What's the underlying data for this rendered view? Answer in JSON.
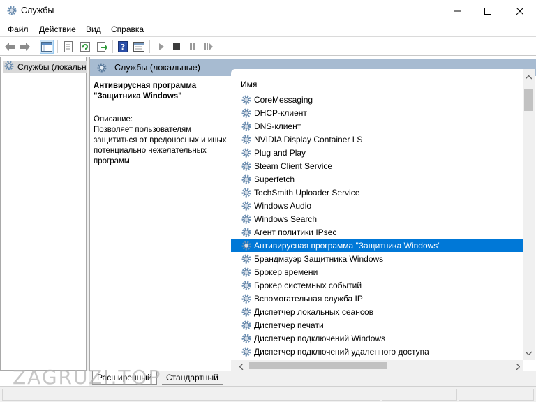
{
  "window": {
    "title": "Службы",
    "icon": "gear-icon"
  },
  "menu": {
    "items": [
      "Файл",
      "Действие",
      "Вид",
      "Справка"
    ]
  },
  "toolbar": {
    "buttons": [
      "back-icon",
      "forward-icon",
      "show-tree-icon",
      "properties-icon",
      "refresh-icon",
      "export-icon",
      "help-icon",
      "console-icon",
      "play-icon",
      "stop-icon",
      "pause-icon",
      "resume-icon"
    ]
  },
  "tree": {
    "root_label": "Службы (локальные)"
  },
  "right_pane": {
    "header_title": "Службы (локальные)",
    "selected_service_name": "Антивирусная программа \"Защитника Windows\"",
    "description_label": "Описание:",
    "description_text": "Позволяет пользователям защититься от вредоносных и иных потенциально нежелательных программ",
    "column_name": "Имя"
  },
  "services": [
    {
      "name": "CoreMessaging",
      "selected": false
    },
    {
      "name": "DHCP-клиент",
      "selected": false
    },
    {
      "name": "DNS-клиент",
      "selected": false
    },
    {
      "name": "NVIDIA Display Container LS",
      "selected": false
    },
    {
      "name": "Plug and Play",
      "selected": false
    },
    {
      "name": "Steam Client Service",
      "selected": false
    },
    {
      "name": "Superfetch",
      "selected": false
    },
    {
      "name": "TechSmith Uploader Service",
      "selected": false
    },
    {
      "name": "Windows Audio",
      "selected": false
    },
    {
      "name": "Windows Search",
      "selected": false
    },
    {
      "name": "Агент политики IPsec",
      "selected": false
    },
    {
      "name": "Антивирусная программа \"Защитника Windows\"",
      "selected": true
    },
    {
      "name": "Брандмауэр Защитника Windows",
      "selected": false
    },
    {
      "name": "Брокер времени",
      "selected": false
    },
    {
      "name": "Брокер системных событий",
      "selected": false
    },
    {
      "name": "Вспомогательная служба IP",
      "selected": false
    },
    {
      "name": "Диспетчер локальных сеансов",
      "selected": false
    },
    {
      "name": "Диспетчер печати",
      "selected": false
    },
    {
      "name": "Диспетчер подключений Windows",
      "selected": false
    },
    {
      "name": "Диспетчер подключений удаленного доступа",
      "selected": false
    }
  ],
  "tabs": {
    "extended": "Расширенный",
    "standard": "Стандартный"
  },
  "watermark": "ZAGRUZI.TOP",
  "colors": {
    "selection": "#0078d7",
    "pane_header": "#a7bbd1"
  }
}
